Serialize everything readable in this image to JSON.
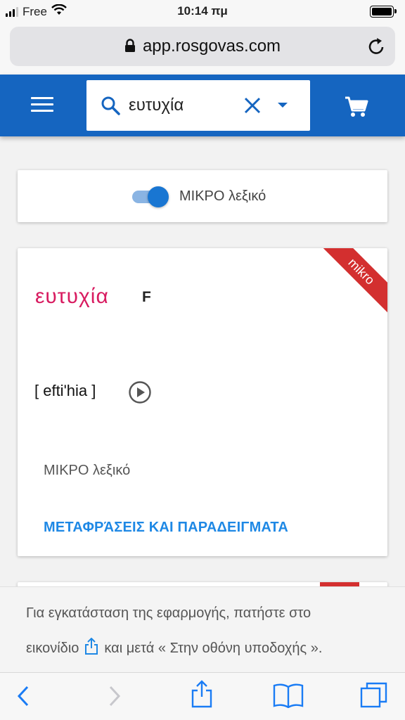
{
  "status_bar": {
    "carrier": "Free",
    "time": "10:14 πμ"
  },
  "browser": {
    "url": "app.rosgovas.com"
  },
  "header": {
    "search": {
      "value": "ευτυχία",
      "placeholder": ""
    }
  },
  "toggle": {
    "label": "ΜΙΚΡΟ λεξικό",
    "on": true
  },
  "entry": {
    "ribbon": "mikro",
    "headword": "ευτυχία",
    "gender": "F",
    "pronunciation": "[ efti'hia ]",
    "dictionary": "ΜΙΚΡΟ λεξικό",
    "link": "ΜΕΤΑΦΡΆΣΕΙΣ ΚΑΙ ΠΑΡΑΔΕΙΓΜΑΤΑ"
  },
  "install_banner": {
    "line1": "Για εγκατάσταση της εφαρμογής, πατήστε στο",
    "line2_prefix": "εικονίδιο",
    "line2_suffix": "και μετά « Στην οθόνη υποδοχής »."
  },
  "colors": {
    "app_bar": "#1565c0",
    "accent": "#1e88e5",
    "headword": "#d81b60",
    "ribbon": "#d32f2f"
  }
}
